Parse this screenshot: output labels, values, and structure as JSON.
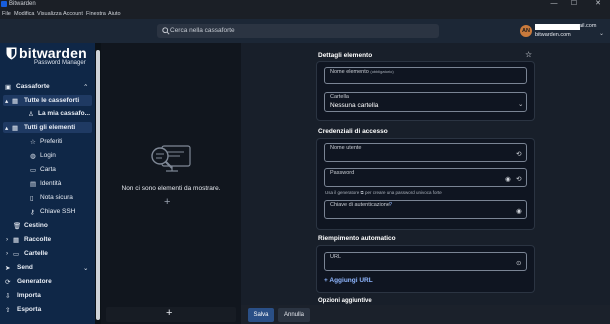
{
  "window": {
    "title": "Bitwarden",
    "controls": [
      "—",
      "☐",
      "✕"
    ]
  },
  "menubar": [
    "File",
    "Modifica",
    "Visualizza",
    "Account",
    "Finestra",
    "Aiuto"
  ],
  "header": {
    "search_placeholder": "Cerca nella cassaforte",
    "avatar_initials": "AN",
    "email_suffix": "ail.com",
    "server": "bitwarden.com"
  },
  "brand": {
    "name": "bitwarden",
    "subtitle": "Password Manager"
  },
  "sidebar": {
    "vault": "Cassaforte",
    "all_vaults": "Tutte le casseforti",
    "my_vault": "La mia cassafo...",
    "all_items": "Tutti gli elementi",
    "favorites": "Preferiti",
    "login": "Login",
    "card": "Carta",
    "identity": "Identità",
    "secure_note": "Nota sicura",
    "ssh_key": "Chiave SSH",
    "trash": "Cestino",
    "collections": "Raccolte",
    "folders": "Cartelle",
    "send": "Send",
    "generator": "Generatore",
    "import": "Importa",
    "export": "Esporta"
  },
  "list": {
    "empty_message": "Non ci sono elementi da mostrare."
  },
  "form": {
    "item_details_title": "Dettagli elemento",
    "item_name_label": "Nome elemento",
    "required_tag": "(obbligatorio)",
    "folder_label": "Cartella",
    "folder_value": "Nessuna cartella",
    "credentials_title": "Credenziali di accesso",
    "username_label": "Nome utente",
    "password_label": "Password",
    "password_hint": "Usa il generatore ⧉ per creare una password univoca forte",
    "auth_key_label": "Chiave di autenticazione",
    "autofill_title": "Riempimento automatico",
    "url_label": "URL",
    "add_url": "Aggiungi URL",
    "additional_title": "Opzioni aggiuntive"
  },
  "footer": {
    "save": "Salva",
    "cancel": "Annulla"
  }
}
